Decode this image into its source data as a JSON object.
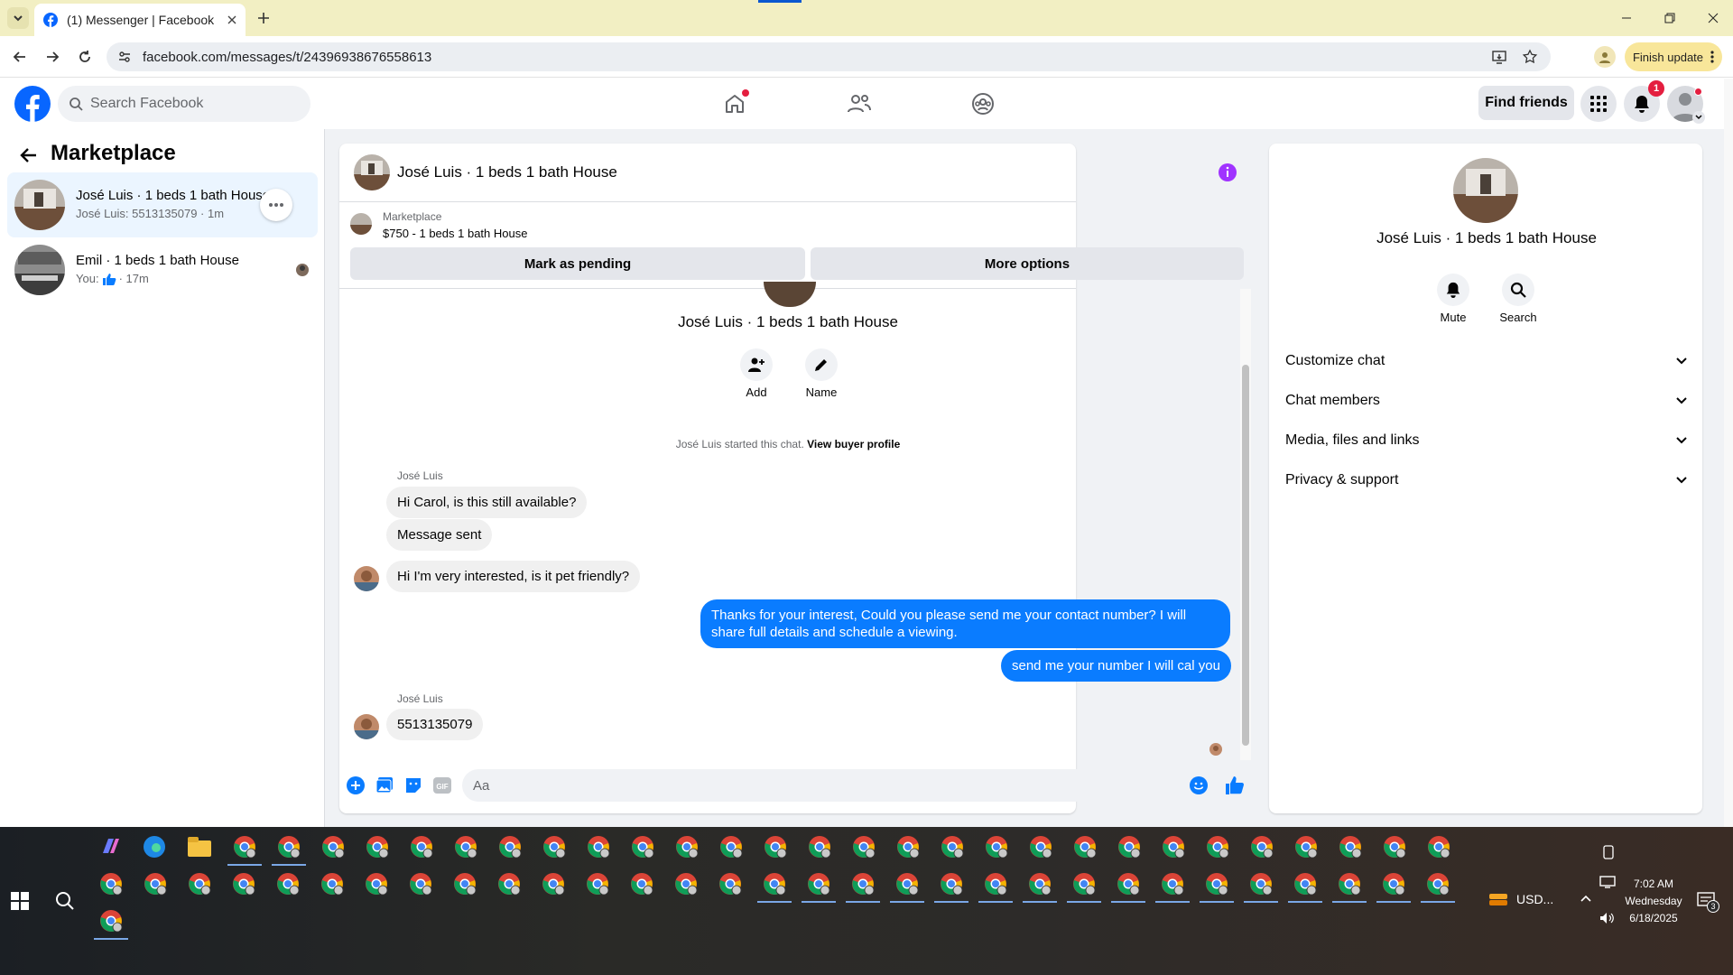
{
  "browser": {
    "tab_title": "(1) Messenger | Facebook",
    "url": "facebook.com/messages/t/24396938676558613",
    "finish_update": "Finish update"
  },
  "header": {
    "search_placeholder": "Search Facebook",
    "find_friends": "Find friends",
    "notification_count": "1"
  },
  "sidebar": {
    "title": "Marketplace",
    "conversations": [
      {
        "title": "José Luis · 1 beds 1 bath House",
        "subtitle": "José Luis: 5513135079 · 1m"
      },
      {
        "title": "Emil · 1 beds 1 bath House",
        "subtitle_prefix": "You:",
        "subtitle_suffix": "· 17m"
      }
    ]
  },
  "chat": {
    "title": "José Luis · 1 beds 1 bath House",
    "listing_label": "Marketplace",
    "listing_price": "$750 - 1 beds 1 bath House",
    "mark_pending": "Mark as pending",
    "more_options": "More options",
    "intro_name": "José Luis · 1 beds 1 bath House",
    "add_label": "Add",
    "name_label": "Name",
    "started_text": "José Luis started this chat.",
    "view_profile": "View buyer profile",
    "sender_name": "José Luis",
    "messages": [
      {
        "text": "Hi Carol, is this still available?"
      },
      {
        "text": "Message sent"
      },
      {
        "text": "Hi I'm very interested, is it pet friendly?"
      },
      {
        "text": "Thanks for your interest, Could you please send me your contact number? I will share full details and schedule a viewing."
      },
      {
        "text": "send me your number I will cal you"
      },
      {
        "text": "5513135079"
      }
    ],
    "composer_placeholder": "Aa"
  },
  "info": {
    "name": "José Luis · 1 beds 1 bath House",
    "mute": "Mute",
    "search": "Search",
    "sections": [
      "Customize chat",
      "Chat members",
      "Media, files and links",
      "Privacy & support"
    ]
  },
  "taskbar": {
    "currency": "USD...",
    "time": "7:02 AM",
    "day": "Wednesday",
    "date": "6/18/2025",
    "notif_count": "3"
  },
  "colors": {
    "facebook_blue": "#0866ff",
    "messenger_blue": "#0a7cff",
    "info_purple": "#a033ff",
    "badge_red": "#e41e3f"
  }
}
